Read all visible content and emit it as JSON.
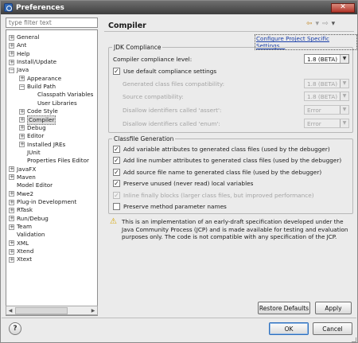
{
  "window": {
    "title": "Preferences"
  },
  "filter": {
    "placeholder": "type filter text"
  },
  "tree": [
    {
      "label": "General",
      "tw": "+",
      "indent": 0
    },
    {
      "label": "Ant",
      "tw": "+",
      "indent": 0
    },
    {
      "label": "Help",
      "tw": "+",
      "indent": 0
    },
    {
      "label": "Install/Update",
      "tw": "+",
      "indent": 0
    },
    {
      "label": "Java",
      "tw": "−",
      "indent": 0
    },
    {
      "label": "Appearance",
      "tw": "+",
      "indent": 1
    },
    {
      "label": "Build Path",
      "tw": "−",
      "indent": 1
    },
    {
      "label": "Classpath Variables",
      "tw": "",
      "indent": 2
    },
    {
      "label": "User Libraries",
      "tw": "",
      "indent": 2
    },
    {
      "label": "Code Style",
      "tw": "+",
      "indent": 1
    },
    {
      "label": "Compiler",
      "tw": "+",
      "indent": 1,
      "selected": true
    },
    {
      "label": "Debug",
      "tw": "+",
      "indent": 1
    },
    {
      "label": "Editor",
      "tw": "+",
      "indent": 1
    },
    {
      "label": "Installed JREs",
      "tw": "+",
      "indent": 1
    },
    {
      "label": "JUnit",
      "tw": "",
      "indent": 1
    },
    {
      "label": "Properties Files Editor",
      "tw": "",
      "indent": 1
    },
    {
      "label": "JavaFX",
      "tw": "+",
      "indent": 0
    },
    {
      "label": "Maven",
      "tw": "+",
      "indent": 0
    },
    {
      "label": "Model Editor",
      "tw": "",
      "indent": 0
    },
    {
      "label": "Mwe2",
      "tw": "+",
      "indent": 0
    },
    {
      "label": "Plug-in Development",
      "tw": "+",
      "indent": 0
    },
    {
      "label": "RTask",
      "tw": "+",
      "indent": 0
    },
    {
      "label": "Run/Debug",
      "tw": "+",
      "indent": 0
    },
    {
      "label": "Team",
      "tw": "+",
      "indent": 0
    },
    {
      "label": "Validation",
      "tw": "",
      "indent": 0
    },
    {
      "label": "XML",
      "tw": "+",
      "indent": 0
    },
    {
      "label": "Xtend",
      "tw": "+",
      "indent": 0
    },
    {
      "label": "Xtext",
      "tw": "+",
      "indent": 0
    }
  ],
  "page": {
    "title": "Compiler",
    "configure_link": "Configure Project Specific Settings..."
  },
  "jdk": {
    "legend": "JDK Compliance",
    "compliance_label": "Compiler compliance level:",
    "compliance_value": "1.8 (BETA)",
    "use_default": "Use default compliance settings",
    "generated_label": "Generated class files compatibility:",
    "generated_value": "1.8 (BETA)",
    "source_label": "Source compatibility:",
    "source_value": "1.8 (BETA)",
    "assert_label": "Disallow identifiers called 'assert':",
    "assert_value": "Error",
    "enum_label": "Disallow identifiers called 'enum':",
    "enum_value": "Error"
  },
  "classfile": {
    "legend": "Classfile Generation",
    "options": [
      {
        "label": "Add variable attributes to generated class files (used by the debugger)",
        "checked": true,
        "disabled": false
      },
      {
        "label": "Add line number attributes to generated class files (used by the debugger)",
        "checked": true,
        "disabled": false
      },
      {
        "label": "Add source file name to generated class file (used by the debugger)",
        "checked": true,
        "disabled": false
      },
      {
        "label": "Preserve unused (never read) local variables",
        "checked": true,
        "disabled": false
      },
      {
        "label": "Inline finally blocks (larger class files, but improved performance)",
        "checked": true,
        "disabled": true
      },
      {
        "label": "Preserve method parameter names",
        "checked": false,
        "disabled": false
      }
    ]
  },
  "warning": "This is an implementation of an early-draft specification developed under the Java Community Process (JCP) and is made available for testing and evaluation purposes only. The code is not compatible with any specification of the JCP.",
  "buttons": {
    "restore": "Restore Defaults",
    "apply": "Apply",
    "ok": "OK",
    "cancel": "Cancel",
    "help": "?"
  }
}
